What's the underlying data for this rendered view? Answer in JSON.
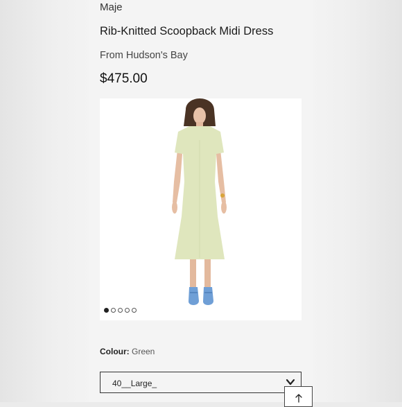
{
  "product": {
    "brand": "Maje",
    "title": "Rib-Knitted Scoopback Midi Dress",
    "retailer": "From Hudson's Bay",
    "price": "$475.00"
  },
  "gallery": {
    "dot_count": 5,
    "active_index": 0,
    "image_icon": "dress-photo"
  },
  "colour": {
    "label": "Colour:",
    "value": "Green"
  },
  "size_select": {
    "selected": "40__Large_",
    "icon": "chevron-down-icon"
  },
  "back_to_top": {
    "icon": "arrow-up-icon"
  },
  "colors": {
    "dress": "#dfe6bd",
    "shoes": "#6f9fd6"
  }
}
